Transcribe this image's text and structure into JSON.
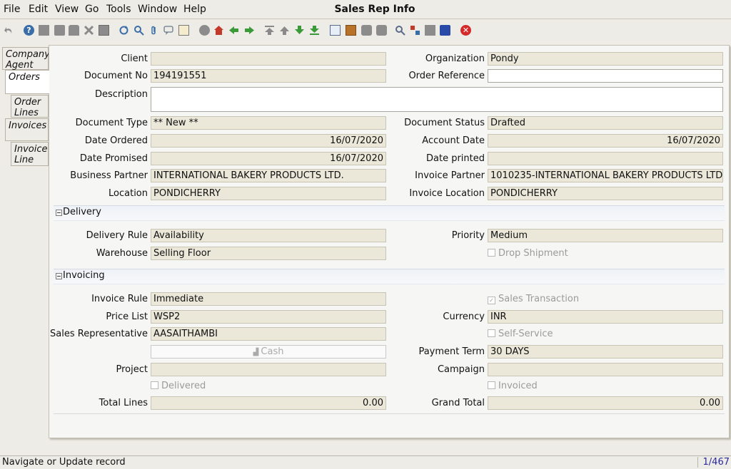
{
  "window": {
    "title": "Sales Rep Info"
  },
  "menu": [
    "File",
    "Edit",
    "View",
    "Go",
    "Tools",
    "Window",
    "Help"
  ],
  "tabs": [
    "Company Agent",
    "Orders",
    "Order Lines",
    "Invoices",
    "Invoice Line"
  ],
  "form": {
    "client_label": "Client",
    "client_value": "",
    "org_label": "Organization",
    "org_value": "Pondy",
    "docno_label": "Document No",
    "docno_value": "194191551",
    "orderref_label": "Order Reference",
    "orderref_value": "",
    "desc_label": "Description",
    "desc_value": "",
    "doctype_label": "Document Type",
    "doctype_value": "** New **",
    "docstatus_label": "Document Status",
    "docstatus_value": "Drafted",
    "dateordered_label": "Date Ordered",
    "dateordered_value": "16/07/2020",
    "acctdate_label": "Account Date",
    "acctdate_value": "16/07/2020",
    "datepromised_label": "Date Promised",
    "datepromised_value": "16/07/2020",
    "dateprinted_label": "Date printed",
    "dateprinted_value": "",
    "bpartner_label": "Business Partner",
    "bpartner_value": "INTERNATIONAL BAKERY PRODUCTS LTD.",
    "invpartner_label": "Invoice Partner",
    "invpartner_value": "1010235-INTERNATIONAL BAKERY PRODUCTS LTD.",
    "location_label": "Location",
    "location_value": "PONDICHERRY",
    "invlocation_label": "Invoice Location",
    "invlocation_value": "PONDICHERRY"
  },
  "delivery": {
    "title": "Delivery",
    "rule_label": "Delivery Rule",
    "rule_value": "Availability",
    "priority_label": "Priority",
    "priority_value": "Medium",
    "warehouse_label": "Warehouse",
    "warehouse_value": "Selling Floor",
    "dropship_label": "Drop Shipment"
  },
  "invoicing": {
    "title": "Invoicing",
    "invrule_label": "Invoice Rule",
    "invrule_value": "Immediate",
    "salestrx_label": "Sales Transaction",
    "pricelist_label": "Price List",
    "pricelist_value": "WSP2",
    "currency_label": "Currency",
    "currency_value": "INR",
    "salesrep_label": "Sales Representative",
    "salesrep_value": "AASAITHAMBI",
    "selfservice_label": "Self-Service",
    "cash_label": "Cash",
    "payterm_label": "Payment Term",
    "payterm_value": "30 DAYS",
    "project_label": "Project",
    "project_value": "",
    "campaign_label": "Campaign",
    "campaign_value": "",
    "delivered_label": "Delivered",
    "invoiced_label": "Invoiced",
    "totallines_label": "Total Lines",
    "totallines_value": "0.00",
    "grandtotal_label": "Grand Total",
    "grandtotal_value": "0.00"
  },
  "status": {
    "message": "Navigate or Update record",
    "record": "1/467"
  },
  "colors": {
    "field_bg": "#ebe8da",
    "close_red": "#d42a2a",
    "nav_green": "#3a9a3a",
    "toolbar_blue": "#3a6ea8"
  }
}
